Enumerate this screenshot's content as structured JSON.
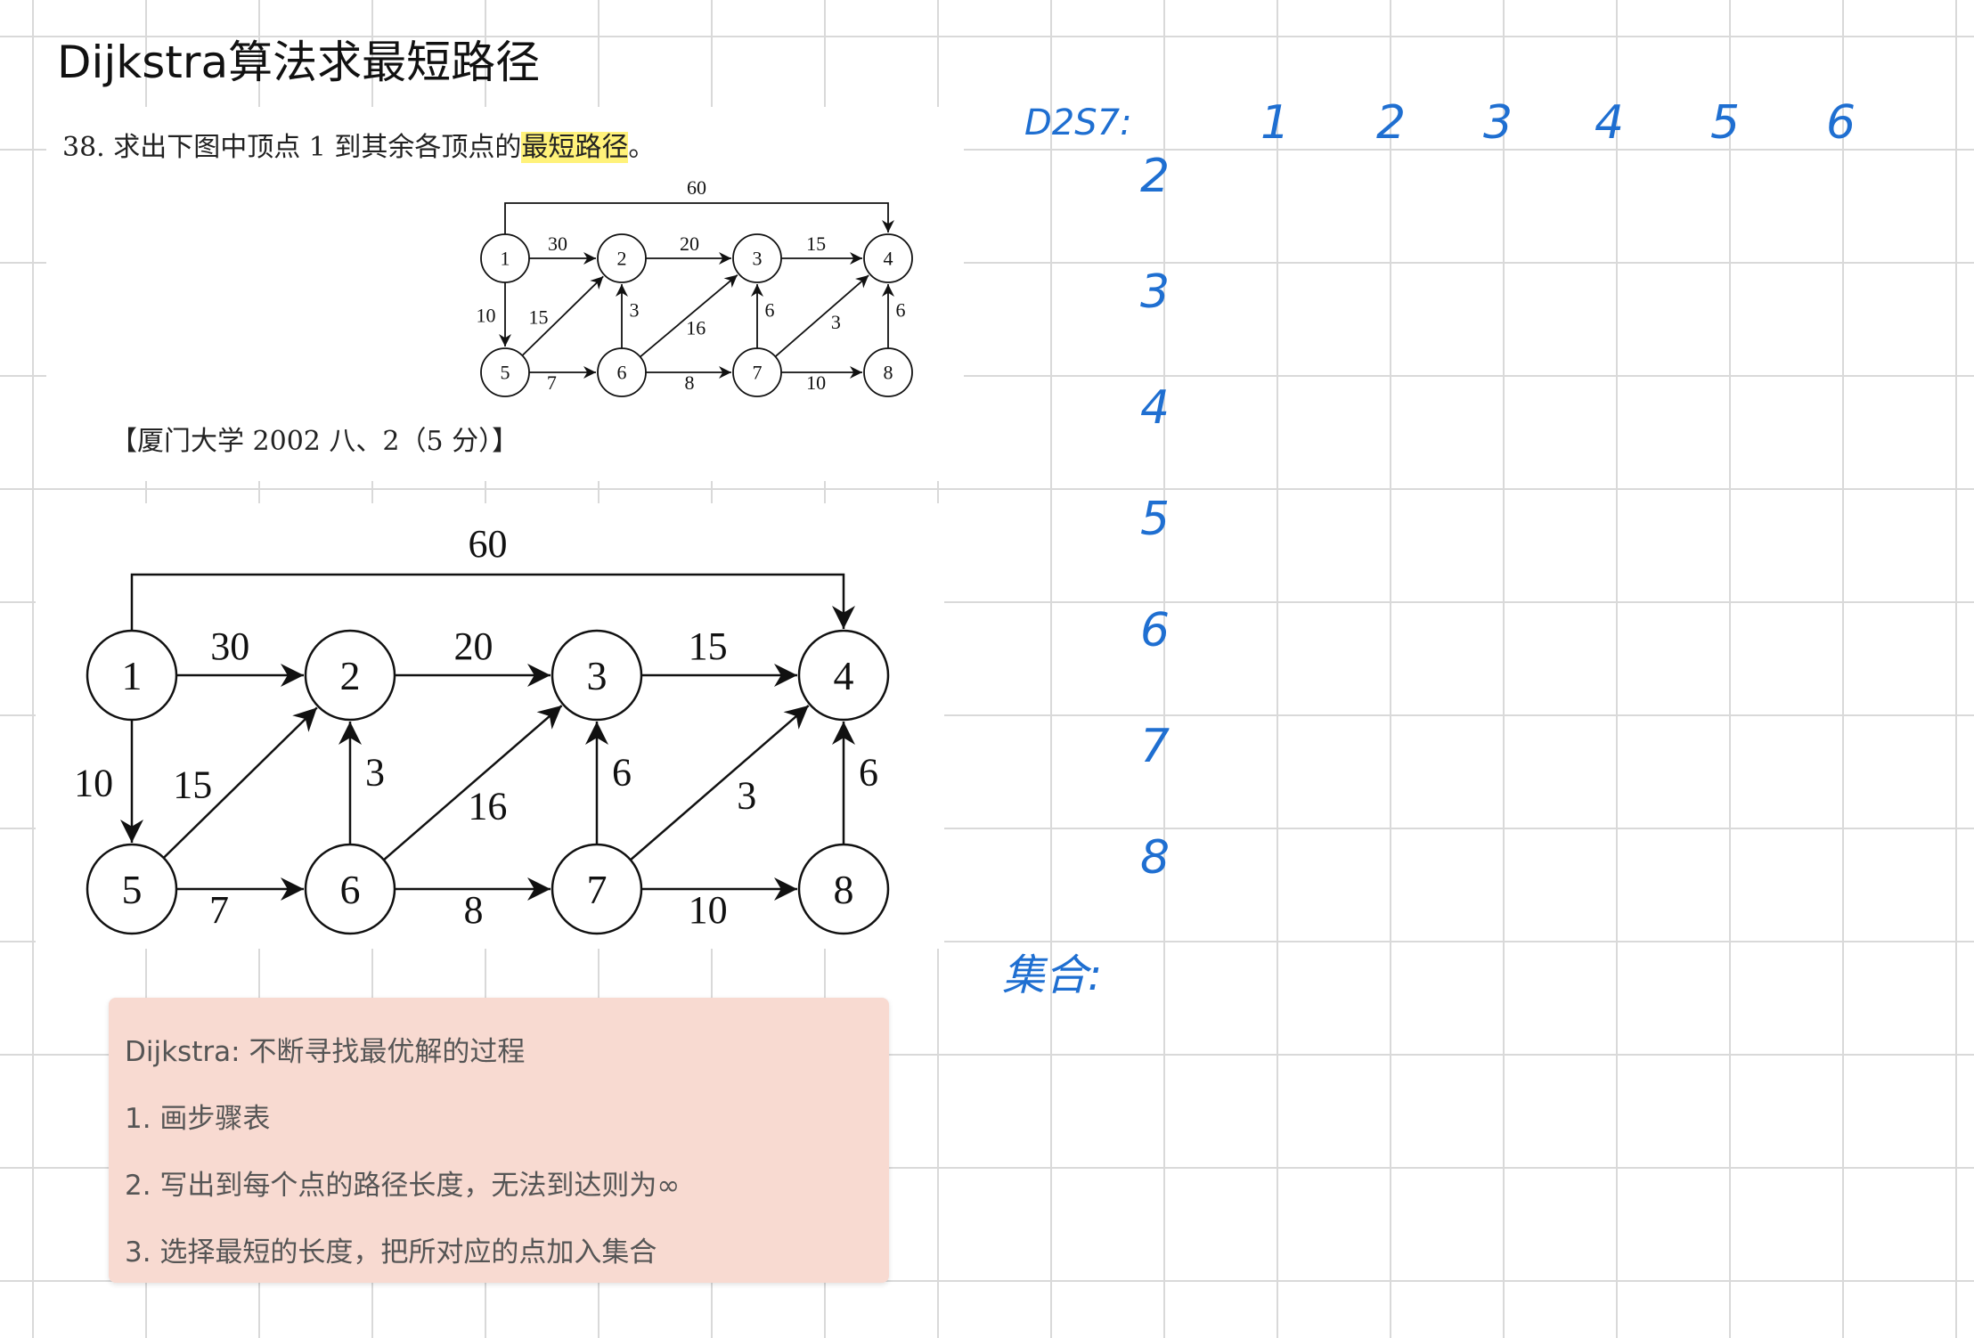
{
  "title": "Dijkstra算法求最短路径",
  "question": {
    "prefix": "38. 求出下图中顶点 1 到其余各顶点的",
    "highlight": "最短路径",
    "suffix": "。",
    "source": "【厦门大学 2002 八、2（5 分）】"
  },
  "graph": {
    "nodes": [
      "1",
      "2",
      "3",
      "4",
      "5",
      "6",
      "7",
      "8"
    ],
    "edges": [
      {
        "from": "1",
        "to": "2",
        "weight": "30"
      },
      {
        "from": "2",
        "to": "3",
        "weight": "20"
      },
      {
        "from": "3",
        "to": "4",
        "weight": "15"
      },
      {
        "from": "1",
        "to": "4",
        "weight": "60"
      },
      {
        "from": "1",
        "to": "5",
        "weight": "10"
      },
      {
        "from": "5",
        "to": "2",
        "weight": "15"
      },
      {
        "from": "6",
        "to": "2",
        "weight": "3"
      },
      {
        "from": "6",
        "to": "3",
        "weight": "16"
      },
      {
        "from": "7",
        "to": "3",
        "weight": "6"
      },
      {
        "from": "7",
        "to": "4",
        "weight": "3"
      },
      {
        "from": "8",
        "to": "4",
        "weight": "6"
      },
      {
        "from": "5",
        "to": "6",
        "weight": "7"
      },
      {
        "from": "6",
        "to": "7",
        "weight": "8"
      },
      {
        "from": "7",
        "to": "8",
        "weight": "10"
      }
    ]
  },
  "notes": {
    "heading": "Dijkstra: 不断寻找最优解的过程",
    "steps": [
      "1.  画步骤表",
      "2. 写出到每个点的路径长度，无法到达则为∞",
      "3. 选择最短的长度，把所对应的点加入集合"
    ]
  },
  "handwriting": {
    "color": "#1f6fd1",
    "table_label": "D2S7:",
    "columns": [
      "1",
      "2",
      "3",
      "4",
      "5",
      "6"
    ],
    "rows": [
      "2",
      "3",
      "4",
      "5",
      "6",
      "7",
      "8"
    ],
    "set_label": "集合:"
  }
}
